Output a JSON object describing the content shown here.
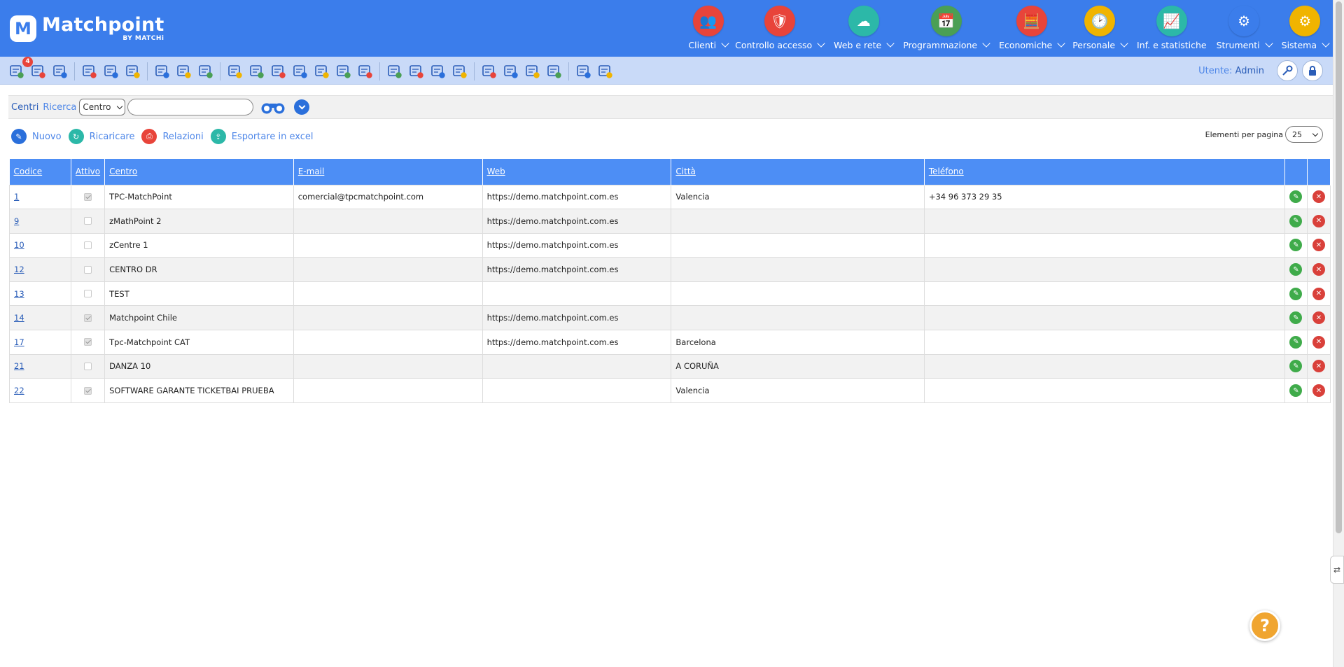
{
  "brand": {
    "name": "Matchpoint",
    "mark": "M",
    "sub": "BY MATCHi"
  },
  "nav": [
    {
      "label": "Clienti",
      "icon": "clients-icon",
      "color": "#e8443a",
      "glyph": "👥"
    },
    {
      "label": "Controllo accesso",
      "icon": "shield-icon",
      "color": "#e8443a",
      "glyph": "🛡"
    },
    {
      "label": "Web e rete",
      "icon": "cloud-icon",
      "color": "#2cb8a8",
      "glyph": "☁"
    },
    {
      "label": "Programmazione",
      "icon": "calendar-icon",
      "color": "#4a9f55",
      "glyph": "📅"
    },
    {
      "label": "Economiche",
      "icon": "calculator-icon",
      "color": "#e8443a",
      "glyph": "🧮"
    },
    {
      "label": "Personale",
      "icon": "staff-icon",
      "color": "#f0b400",
      "glyph": "🕑"
    },
    {
      "label": "Inf. e statistiche",
      "icon": "stats-icon",
      "color": "#2cb8a8",
      "glyph": "📈"
    },
    {
      "label": "Strumenti",
      "icon": "tools-icon",
      "color": "#3b7deb",
      "glyph": "⚙"
    },
    {
      "label": "Sistema",
      "icon": "system-icon",
      "color": "#f0b400",
      "glyph": "⚙"
    }
  ],
  "toolbar": {
    "badge_count": "4"
  },
  "user": {
    "label": "Utente:",
    "name": "Admin"
  },
  "search": {
    "section": "Centri",
    "label": "Ricerca",
    "field": "Centro",
    "value": ""
  },
  "actions": [
    {
      "label": "Nuovo",
      "icon": "new-icon",
      "color": "#2a6fdb"
    },
    {
      "label": "Ricaricare",
      "icon": "reload-icon",
      "color": "#2cb8a8"
    },
    {
      "label": "Relazioni",
      "icon": "report-icon",
      "color": "#e8443a"
    },
    {
      "label": "Esportare in excel",
      "icon": "excel-icon",
      "color": "#2cb8a8"
    }
  ],
  "perpage": {
    "label": "Elementi per pagina",
    "value": "25"
  },
  "table": {
    "headers": [
      "Codice",
      "Attivo",
      "Centro",
      "E-mail",
      "Web",
      "Città",
      "Teléfono"
    ],
    "rows": [
      {
        "code": "1",
        "active": true,
        "centre": "TPC-MatchPoint",
        "email": "comercial@tpcmatchpoint.com",
        "web": "https://demo.matchpoint.com.es",
        "city": "Valencia",
        "phone": "+34 96 373 29 35"
      },
      {
        "code": "9",
        "active": false,
        "centre": "zMathPoint 2",
        "email": "",
        "web": "https://demo.matchpoint.com.es",
        "city": "",
        "phone": ""
      },
      {
        "code": "10",
        "active": false,
        "centre": "zCentre 1",
        "email": "",
        "web": "https://demo.matchpoint.com.es",
        "city": "",
        "phone": ""
      },
      {
        "code": "12",
        "active": false,
        "centre": "CENTRO DR",
        "email": "",
        "web": "https://demo.matchpoint.com.es",
        "city": "",
        "phone": ""
      },
      {
        "code": "13",
        "active": false,
        "centre": "TEST",
        "email": "",
        "web": "",
        "city": "",
        "phone": ""
      },
      {
        "code": "14",
        "active": true,
        "centre": "Matchpoint Chile",
        "email": "",
        "web": "https://demo.matchpoint.com.es",
        "city": "",
        "phone": ""
      },
      {
        "code": "17",
        "active": true,
        "centre": "Tpc-Matchpoint CAT",
        "email": "",
        "web": "https://demo.matchpoint.com.es",
        "city": "Barcelona",
        "phone": ""
      },
      {
        "code": "21",
        "active": false,
        "centre": "DANZA 10",
        "email": "",
        "web": "",
        "city": "A CORUÑA",
        "phone": ""
      },
      {
        "code": "22",
        "active": true,
        "centre": "SOFTWARE GARANTE TICKETBAI PRUEBA",
        "email": "",
        "web": "",
        "city": "Valencia",
        "phone": ""
      }
    ]
  },
  "help": {
    "label": "?"
  }
}
